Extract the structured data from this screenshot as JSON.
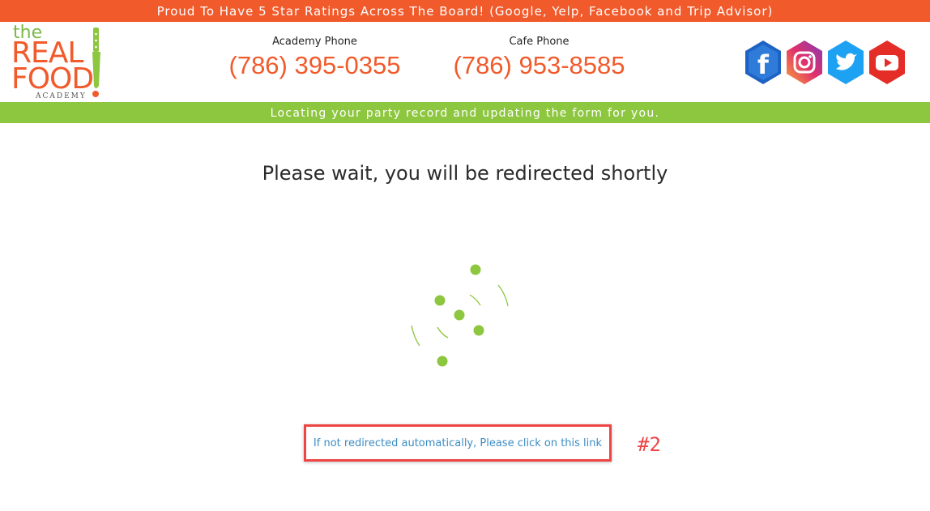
{
  "top_banner": {
    "text": "Proud To Have 5 Star Ratings Across The Board! (Google, Yelp, Facebook and Trip Advisor)"
  },
  "logo": {
    "the": "the",
    "real": "REAL",
    "food": "FOOD",
    "academy": "ACADEMY"
  },
  "phones": [
    {
      "label": "Academy Phone",
      "number": "(786) 395-0355"
    },
    {
      "label": "Cafe Phone",
      "number": "(786) 953-8585"
    }
  ],
  "social": [
    "facebook-icon",
    "instagram-icon",
    "twitter-icon",
    "youtube-icon"
  ],
  "status_bar": {
    "text": "Locating your party record and updating the form for you."
  },
  "main": {
    "wait_text": "Please wait, you will be redirected shortly",
    "redirect_link": "If not redirected automatically, Please click on this link",
    "annotation": "#2"
  },
  "colors": {
    "brand_orange": "#f15a2b",
    "brand_green": "#8dc63f",
    "link_blue": "#3c8dc5",
    "annotation_red": "#ee4444"
  }
}
